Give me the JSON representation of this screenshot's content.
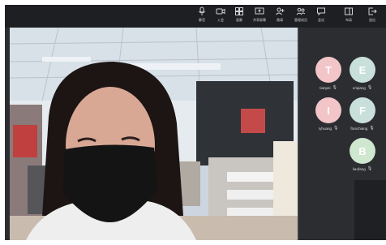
{
  "toolbar": {
    "tools": [
      {
        "label": "静音",
        "icon": "mic-icon"
      },
      {
        "label": "入会",
        "icon": "video-icon"
      },
      {
        "label": "画廊",
        "icon": "gallery-icon"
      },
      {
        "label": "共享屏幕",
        "icon": "share-screen-icon"
      },
      {
        "label": "邀请",
        "icon": "invite-icon"
      },
      {
        "label": "管理成员",
        "icon": "members-icon"
      },
      {
        "label": "会议",
        "icon": "chat-icon"
      },
      {
        "label": "布局",
        "icon": "layout-icon"
      },
      {
        "label": "退出",
        "icon": "exit-icon"
      }
    ]
  },
  "participants": [
    {
      "initial": "T",
      "name": "tianpei",
      "color": "#f2c5c8"
    },
    {
      "initial": "E",
      "name": "eriqiang",
      "color": "#c9e0da"
    },
    {
      "initial": "I",
      "name": "ryhuang",
      "color": "#f2c5c8"
    },
    {
      "initial": "F",
      "name": "franchiang",
      "color": "#c9e0da"
    },
    {
      "initial": "B",
      "name": "liaofang",
      "color": "#cfe6cf"
    }
  ],
  "colors": {
    "toolbar_bg": "#1e1f22",
    "panel_bg": "#2b2d31"
  }
}
